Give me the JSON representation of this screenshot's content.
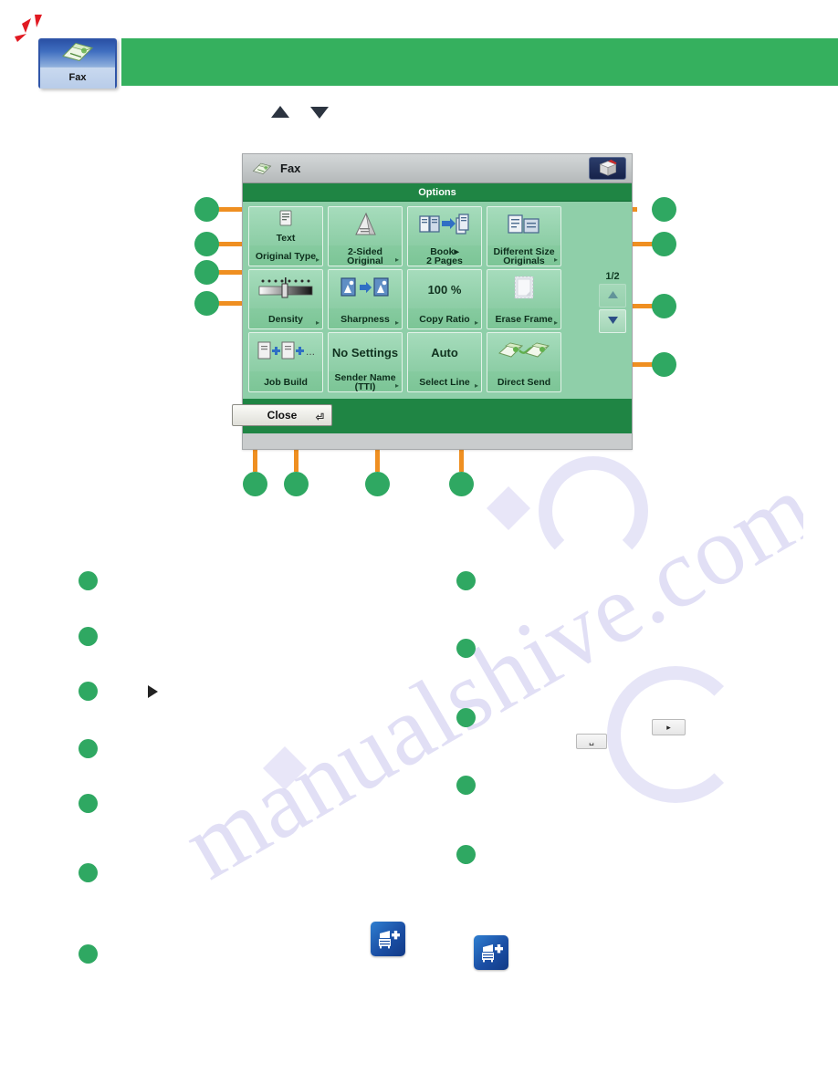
{
  "header": {
    "tab": {
      "label": "Fax",
      "icon": "fax-machine-icon",
      "sparkle_icon": "red-sparkle-icon"
    },
    "banner_color": "#35b05e",
    "scroll_up_icon": "triangle-up-icon",
    "scroll_down_icon": "triangle-down-icon"
  },
  "panel": {
    "title": "Fax",
    "title_icon": "fax-machine-icon",
    "cube_button_icon": "3d-cube-icon",
    "options_bar_label": "Options",
    "page_indicator": "1/2",
    "page_up_icon": "triangle-up-icon",
    "page_down_icon": "triangle-down-icon",
    "close_label": "Close",
    "close_return_icon": "return-arrow-icon",
    "options": [
      {
        "value": "Text",
        "label": "Original Type",
        "icon": "document-text-icon",
        "has_arrow": true
      },
      {
        "value": "",
        "label": "2-Sided\nOriginal",
        "icon": "two-sided-page-icon",
        "has_arrow": true
      },
      {
        "value": "",
        "label": "Book▸\n2 Pages",
        "icon": "book-to-pages-icon",
        "has_arrow": false
      },
      {
        "value": "",
        "label": "Different Size\nOriginals",
        "icon": "different-size-originals-icon",
        "has_arrow": true
      },
      {
        "value": "",
        "label": "Density",
        "icon": "density-slider-icon",
        "has_arrow": true
      },
      {
        "value": "",
        "label": "Sharpness",
        "icon": "sharpness-icon",
        "has_arrow": true
      },
      {
        "value": "100 %",
        "label": "Copy Ratio",
        "icon": "",
        "has_arrow": true
      },
      {
        "value": "",
        "label": "Erase Frame",
        "icon": "erase-frame-page-icon",
        "has_arrow": true
      },
      {
        "value": "",
        "label": "Job Build",
        "icon": "job-build-icon",
        "has_arrow": false
      },
      {
        "value": "No Settings",
        "label": "Sender Name\n(TTI)",
        "icon": "",
        "has_arrow": true
      },
      {
        "value": "Auto",
        "label": "Select Line",
        "icon": "",
        "has_arrow": true
      },
      {
        "value": "",
        "label": "Direct Send",
        "icon": "direct-send-icon",
        "has_arrow": false
      }
    ]
  },
  "callouts": {
    "leader_color": "#ef8f21",
    "dot_color": "#2fa862",
    "left": [
      {
        "target": "options-bar"
      },
      {
        "target": "original-type"
      },
      {
        "target": "book-2-pages"
      },
      {
        "target": "density"
      }
    ],
    "right": [
      {
        "target": "options-bar-right"
      },
      {
        "target": "different-size-originals"
      },
      {
        "target": "erase-frame"
      },
      {
        "target": "direct-send"
      }
    ],
    "bottom": [
      {
        "target": "density-bottom"
      },
      {
        "target": "job-build"
      },
      {
        "target": "sender-name-tti"
      },
      {
        "target": "select-line"
      }
    ]
  },
  "description": {
    "left_bullets": 7,
    "right_bullets": 5,
    "play_icon": "play-triangle-icon",
    "mini_buttons": [
      {
        "glyph": "␣",
        "name": "small-blank-button"
      },
      {
        "glyph": "▸",
        "name": "small-arrow-button"
      }
    ],
    "blue_icons": [
      {
        "name": "add-copier-icon"
      },
      {
        "name": "add-copier-icon"
      }
    ]
  },
  "watermark": {
    "text": "manualshive.com"
  }
}
